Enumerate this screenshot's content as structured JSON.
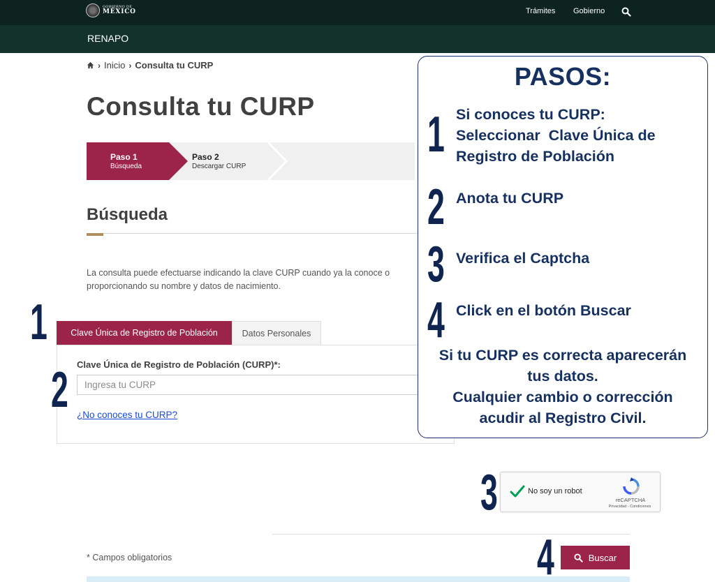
{
  "header": {
    "logo_small": "GOBIERNO DE",
    "logo_big": "MÉXICO",
    "nav": [
      "Trámites",
      "Gobierno"
    ],
    "search_icon": "search-icon",
    "subtitle": "RENAPO"
  },
  "breadcrumb": {
    "home_icon": "home-icon",
    "items": [
      "Inicio",
      "Consulta tu CURP"
    ]
  },
  "page_title": "Consulta tu CURP",
  "steps": [
    {
      "title": "Paso 1",
      "subtitle": "Búsqueda",
      "active": true
    },
    {
      "title": "Paso 2",
      "subtitle": "Descargar CURP",
      "active": false
    }
  ],
  "section": {
    "title": "Búsqueda",
    "description": "La consulta puede efectuarse indicando la clave CURP cuando ya la conoce o proporcionando su nombre y datos de nacimiento."
  },
  "tabs": [
    "Clave Única de Registro de Población",
    "Datos Personales"
  ],
  "form": {
    "field_label": "Clave Única de Registro de Población (CURP)*:",
    "input_value": "",
    "input_placeholder": "Ingresa tu CURP",
    "link_text": "¿No conoces tu CURP?"
  },
  "step_markers": [
    "1",
    "2",
    "3",
    "4"
  ],
  "pasos": {
    "title": "PASOS:",
    "items": [
      {
        "number": "1",
        "lines": [
          "Si conoces tu CURP:",
          "Seleccionar  Clave Única de",
          "Registro de Población"
        ]
      },
      {
        "number": "2",
        "lines": [
          "Anota tu CURP"
        ]
      },
      {
        "number": "3",
        "lines": [
          "Verifica el Captcha"
        ]
      },
      {
        "number": "4",
        "lines": [
          "Click en el botón Buscar"
        ]
      }
    ],
    "footer": [
      "Si tu CURP es correcta aparecerán",
      "tus datos.",
      "Cualquier cambio o corrección",
      "acudir al Registro Civil."
    ]
  },
  "captcha": {
    "label": "No soy un robot",
    "brand": "reCAPTCHA",
    "terms": "Privacidad - Condiciones",
    "checked": true
  },
  "footer": {
    "required_note": "* Campos obligatorios",
    "search_button": "Buscar"
  },
  "colors": {
    "guinda": "#9d2449",
    "dark_green": "#13322b",
    "darker_green": "#0c231e",
    "pasos_blue": "#16305f",
    "marker_blue": "#0f2550",
    "link_blue": "#1a4bd6",
    "gold_accent": "#b38e5d"
  }
}
